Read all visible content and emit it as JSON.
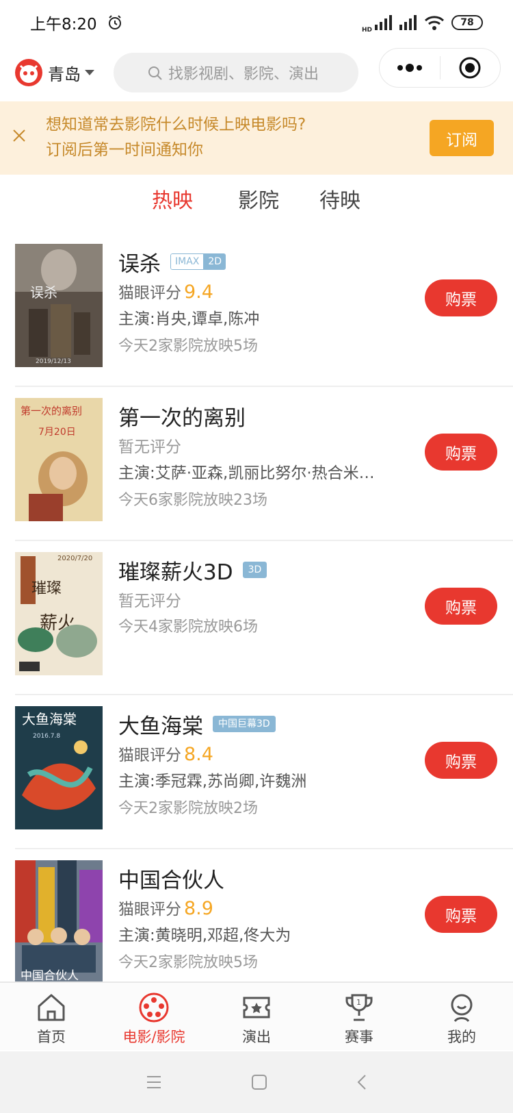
{
  "status_bar": {
    "time": "上午8:20",
    "network": "HD",
    "battery": "78"
  },
  "header": {
    "city": "青岛",
    "search_placeholder": "找影视剧、影院、演出"
  },
  "banner": {
    "line1": "想知道常去影院什么时候上映电影吗?",
    "line2": "订阅后第一时间通知你",
    "button": "订阅"
  },
  "tabs": [
    {
      "label": "热映",
      "active": true
    },
    {
      "label": "影院",
      "active": false
    },
    {
      "label": "待映",
      "active": false
    }
  ],
  "movies": [
    {
      "title": "误杀",
      "tag_left": "IMAX",
      "tag_right": "2D",
      "score_label": "猫眼评分",
      "score": "9.4",
      "actors": "主演:肖央,谭卓,陈冲",
      "showing": "今天2家影院放映5场",
      "button": "购票",
      "poster_text": "2019/12/13"
    },
    {
      "title": "第一次的离别",
      "score_label": "暂无评分",
      "actors": "主演:艾萨·亚森,凯丽比努尔·热合米…",
      "showing": "今天6家影院放映23场",
      "button": "购票",
      "poster_text": "7月20日"
    },
    {
      "title": "璀璨薪火3D",
      "tag_solo": "3D",
      "score_label": "暂无评分",
      "showing": "今天4家影院放映6场",
      "button": "购票",
      "poster_text": "2020/7/20"
    },
    {
      "title": "大鱼海棠",
      "tag_solo": "中国巨幕3D",
      "score_label": "猫眼评分",
      "score": "8.4",
      "actors": "主演:季冠霖,苏尚卿,许魏洲",
      "showing": "今天2家影院放映2场",
      "button": "购票",
      "poster_text": "2016.7.8"
    },
    {
      "title": "中国合伙人",
      "score_label": "猫眼评分",
      "score": "8.9",
      "actors": "主演:黄晓明,邓超,佟大为",
      "showing": "今天2家影院放映5场",
      "button": "购票",
      "poster_text": ""
    }
  ],
  "bottom_nav": [
    {
      "label": "首页",
      "icon": "home-icon"
    },
    {
      "label": "电影/影院",
      "icon": "film-reel-icon",
      "active": true
    },
    {
      "label": "演出",
      "icon": "ticket-icon"
    },
    {
      "label": "赛事",
      "icon": "trophy-icon"
    },
    {
      "label": "我的",
      "icon": "profile-icon"
    }
  ],
  "colors": {
    "accent": "#e8382f",
    "score": "#f5a623",
    "banner_bg": "#fdf0dc",
    "banner_text": "#c6892a",
    "tag": "#8ab7d5"
  }
}
